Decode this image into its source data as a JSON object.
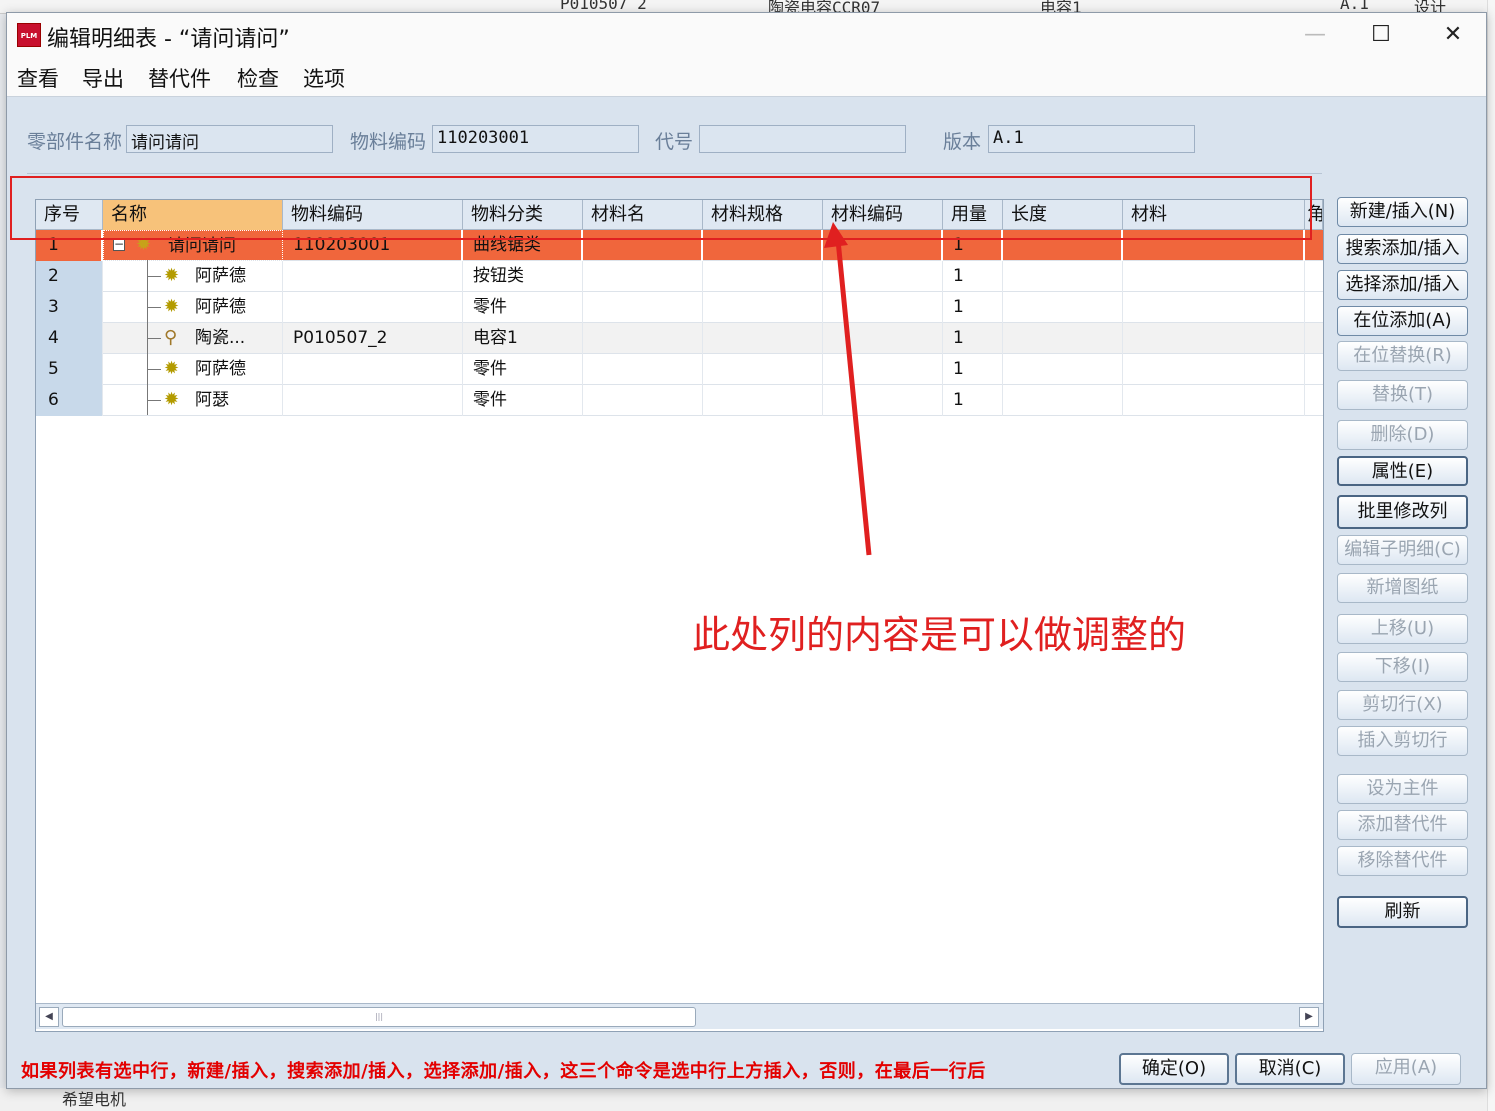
{
  "background": {
    "top_texts": [
      "P010507_2",
      "陶瓷电容CCR07",
      "电容1",
      "A.1",
      "设计"
    ],
    "bottom_text": "希望电机"
  },
  "window": {
    "title": "编辑明细表 - “请问请问”",
    "app_icon_text": "PLM"
  },
  "menu": [
    "查看",
    "导出",
    "替代件",
    "检查",
    "选项"
  ],
  "fields": {
    "part_name_label": "零部件名称",
    "part_name_value": "请问请问",
    "material_code_label": "物料编码",
    "material_code_value": "110203001",
    "code_label": "代号",
    "code_value": "",
    "version_label": "版本",
    "version_value": "A.1"
  },
  "table": {
    "columns": [
      "序号",
      "名称",
      "物料编码",
      "物料分类",
      "材料名",
      "材料规格",
      "材料编码",
      "用量",
      "长度",
      "材料",
      "角"
    ],
    "rows": [
      {
        "idx": "1",
        "name": "请问请问",
        "code": "110203001",
        "category": "曲线锯类",
        "qty": "1"
      },
      {
        "idx": "2",
        "name": "阿萨德",
        "code": "",
        "category": "按钮类",
        "qty": "1"
      },
      {
        "idx": "3",
        "name": "阿萨德",
        "code": "",
        "category": "零件",
        "qty": "1"
      },
      {
        "idx": "4",
        "name": "陶瓷...",
        "code": "P010507_2",
        "category": "电容1",
        "qty": "1"
      },
      {
        "idx": "5",
        "name": "阿萨德",
        "code": "",
        "category": "零件",
        "qty": "1"
      },
      {
        "idx": "6",
        "name": "阿瑟",
        "code": "",
        "category": "零件",
        "qty": "1"
      }
    ],
    "selected_row_color": "#f0663c"
  },
  "side_buttons": [
    {
      "label": "新建/插入(N)",
      "enabled": true
    },
    {
      "label": "搜索添加/插入",
      "enabled": true
    },
    {
      "label": "选择添加/插入",
      "enabled": true
    },
    {
      "label": "在位添加(A)",
      "enabled": true
    },
    {
      "label": "在位替换(R)",
      "enabled": false
    },
    {
      "label": "替换(T)",
      "enabled": false
    },
    {
      "label": "删除(D)",
      "enabled": false
    },
    {
      "label": "属性(E)",
      "enabled": true
    },
    {
      "label": "批里修改列",
      "enabled": true
    },
    {
      "label": "编辑子明细(C)",
      "enabled": false
    },
    {
      "label": "新增图纸",
      "enabled": false
    },
    {
      "label": "上移(U)",
      "enabled": false
    },
    {
      "label": "下移(I)",
      "enabled": false
    },
    {
      "label": "剪切行(X)",
      "enabled": false
    },
    {
      "label": "插入剪切行",
      "enabled": false
    },
    {
      "label": "设为主件",
      "enabled": false
    },
    {
      "label": "添加替代件",
      "enabled": false
    },
    {
      "label": "移除替代件",
      "enabled": false
    },
    {
      "label": "刷新",
      "enabled": true
    }
  ],
  "footer": {
    "note": "如果列表有选中行，新建/插入，搜索添加/插入，选择添加/插入，这三个命令是选中行上方插入，否则，在最后一行后",
    "ok": "确定(O)",
    "cancel": "取消(C)",
    "apply": "应用(A)"
  },
  "annotation": {
    "text": "此处列的内容是可以做调整的",
    "color": "#e02020"
  }
}
